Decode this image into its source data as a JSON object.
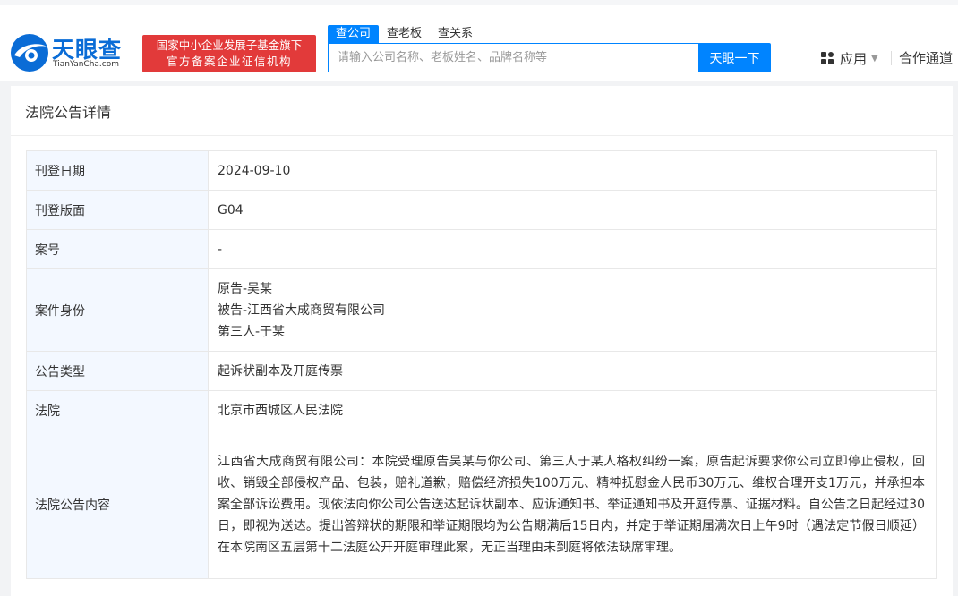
{
  "brand": {
    "name_cn": "天眼查",
    "name_en": "TianYanCha.com",
    "slogan_line1": "国家中小企业发展子基金旗下",
    "slogan_line2": "官方备案企业征信机构",
    "color": "#0a6cd6"
  },
  "search": {
    "tabs": [
      {
        "label": "查公司",
        "active": true
      },
      {
        "label": "查老板",
        "active": false
      },
      {
        "label": "查关系",
        "active": false
      }
    ],
    "placeholder": "请输入公司名称、老板姓名、品牌名称等",
    "button_label": "天眼一下",
    "accent": "#0084ff"
  },
  "nav": {
    "apps_label": "应用",
    "cooperation_label": "合作通道"
  },
  "page": {
    "title": "法院公告详情"
  },
  "detail": {
    "rows": [
      {
        "key": "刊登日期",
        "value": "2024-09-10"
      },
      {
        "key": "刊登版面",
        "value": "G04"
      },
      {
        "key": "案号",
        "value": "-"
      },
      {
        "key": "案件身份",
        "lines": [
          "原告-吴某",
          "被告-江西省大成商贸有限公司",
          "第三人-于某"
        ]
      },
      {
        "key": "公告类型",
        "value": "起诉状副本及开庭传票"
      },
      {
        "key": "法院",
        "value": "北京市西城区人民法院"
      },
      {
        "key": "法院公告内容",
        "value": "江西省大成商贸有限公司：本院受理原告吴某与你公司、第三人于某人格权纠纷一案，原告起诉要求你公司立即停止侵权，回收、销毁全部侵权产品、包装，赔礼道歉，赔偿经济损失100万元、精神抚慰金人民币30万元、维权合理开支1万元，并承担本案全部诉讼费用。现依法向你公司公告送达起诉状副本、应诉通知书、举证通知书及开庭传票、证据材料。自公告之日起经过30日，即视为送达。提出答辩状的期限和举证期限均为公告期满后15日内，并定于举证期届满次日上午9时（遇法定节假日顺延）在本院南区五层第十二法庭公开开庭审理此案，无正当理由未到庭将依法缺席审理。"
      }
    ]
  }
}
